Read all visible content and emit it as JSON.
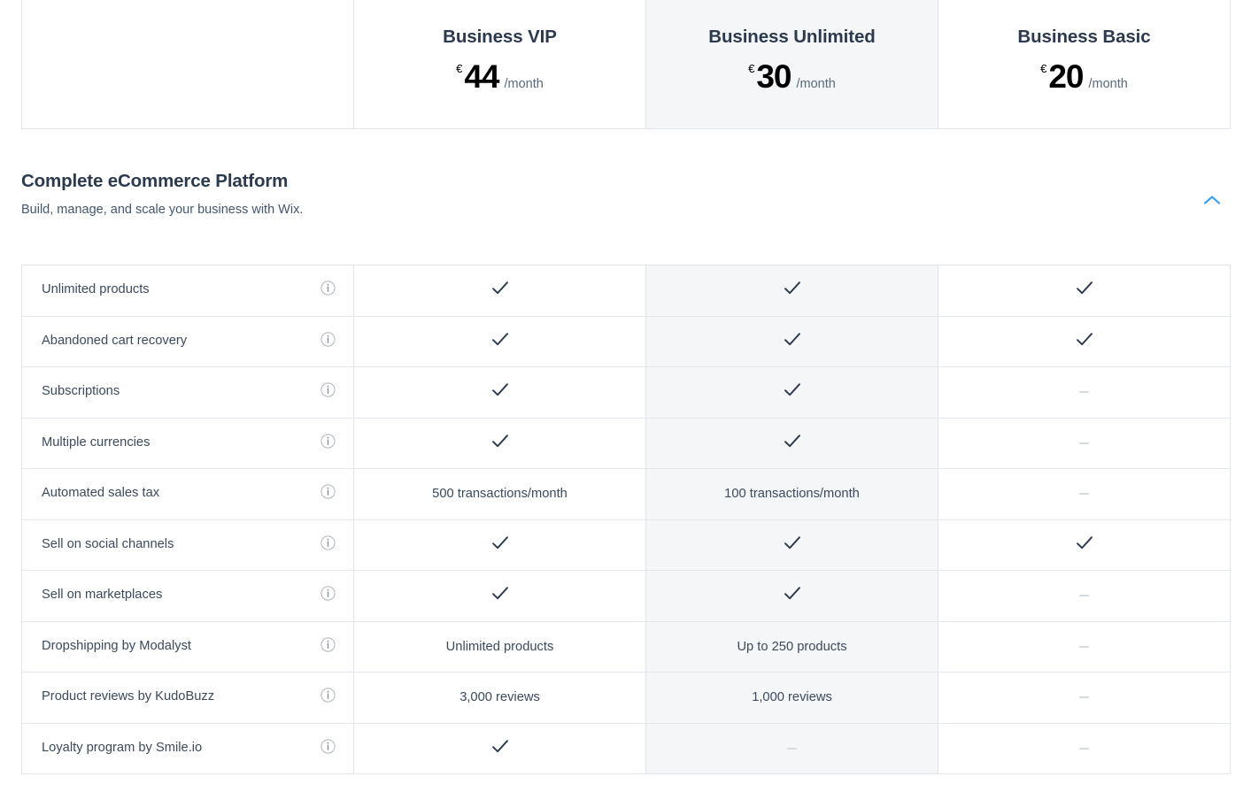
{
  "plans_header": {
    "spacer_label": "",
    "plans": [
      {
        "name": "Business VIP",
        "currency": "€",
        "amount": "44",
        "period": "/month",
        "highlighted": false
      },
      {
        "name": "Business Unlimited",
        "currency": "€",
        "amount": "30",
        "period": "/month",
        "highlighted": true
      },
      {
        "name": "Business Basic",
        "currency": "€",
        "amount": "20",
        "period": "/month",
        "highlighted": false
      }
    ]
  },
  "section": {
    "title": "Complete eCommerce Platform",
    "subtitle": "Build, manage, and scale your business with Wix.",
    "collapse_icon": "chevron-up-icon",
    "collapse_icon_color": "#2b9bf4",
    "expanded": true
  },
  "icons": {
    "info": "info-icon",
    "check": "check-icon",
    "dash": "dash-icon"
  },
  "colors": {
    "check": "#2b3a4f",
    "dash": "#d5dade",
    "border": "#dfe5eb",
    "highlight_column_bg": "#f5f6f8",
    "heading": "#2b3a4f",
    "body_text": "#3b4a5c",
    "accent": "#2b9bf4"
  },
  "features": [
    {
      "label": "Unlimited products",
      "info": "info-icon",
      "values": [
        "check",
        "check",
        "check"
      ]
    },
    {
      "label": "Abandoned cart recovery",
      "info": "info-icon",
      "values": [
        "check",
        "check",
        "check"
      ]
    },
    {
      "label": "Subscriptions",
      "info": "info-icon",
      "values": [
        "check",
        "check",
        "dash"
      ]
    },
    {
      "label": "Multiple currencies",
      "info": "info-icon",
      "values": [
        "check",
        "check",
        "dash"
      ]
    },
    {
      "label": "Automated sales tax",
      "info": "info-icon",
      "values": [
        "500 transactions/month",
        "100 transactions/month",
        "dash"
      ]
    },
    {
      "label": "Sell on social channels",
      "info": "info-icon",
      "values": [
        "check",
        "check",
        "check"
      ]
    },
    {
      "label": "Sell on marketplaces",
      "info": "info-icon",
      "values": [
        "check",
        "check",
        "dash"
      ]
    },
    {
      "label": "Dropshipping by Modalyst",
      "info": "info-icon",
      "values": [
        "Unlimited products",
        "Up to 250 products",
        "dash"
      ]
    },
    {
      "label": "Product reviews by KudoBuzz",
      "info": "info-icon",
      "values": [
        "3,000 reviews",
        "1,000 reviews",
        "dash"
      ]
    },
    {
      "label": "Loyalty program by Smile.io",
      "info": "info-icon",
      "values": [
        "check",
        "dash",
        "dash"
      ]
    }
  ]
}
